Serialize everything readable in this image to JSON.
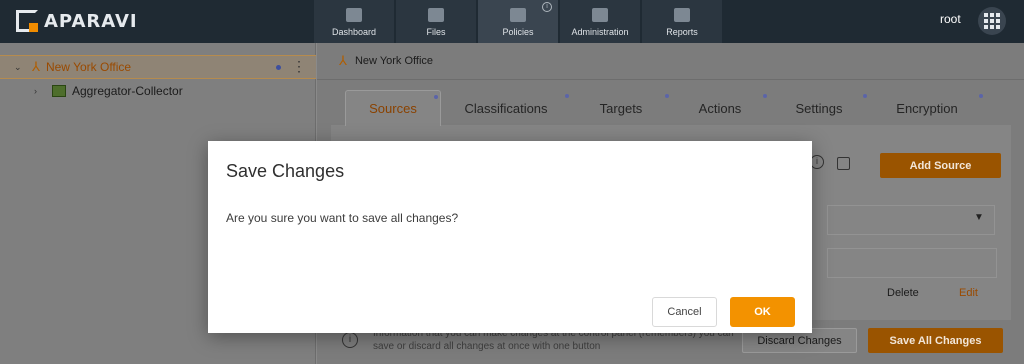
{
  "brand": {
    "name": "APARAVI",
    "trademark": "®"
  },
  "nav": {
    "items": [
      {
        "label": "Dashboard",
        "icon": "dashboard-icon"
      },
      {
        "label": "Files",
        "icon": "folder-icon"
      },
      {
        "label": "Policies",
        "icon": "policies-icon",
        "active": true
      },
      {
        "label": "Administration",
        "icon": "users-icon"
      },
      {
        "label": "Reports",
        "icon": "clipboard-icon"
      }
    ]
  },
  "user": {
    "name": "root"
  },
  "tree": {
    "items": [
      {
        "label": "New York Office",
        "chevron": "⌄",
        "selected": true
      },
      {
        "label": "Aggregator-Collector",
        "chevron": "›"
      }
    ]
  },
  "breadcrumb": {
    "label": "New York Office"
  },
  "tabs": [
    "Sources",
    "Classifications",
    "Targets",
    "Actions",
    "Settings",
    "Encryption"
  ],
  "content": {
    "add_source": "Add Source",
    "delete": "Delete",
    "edit": "Edit",
    "info_line1": "Information that you can make changes at the control panel (remembers) you can",
    "info_line2": "save or discard all changes at once with one button",
    "discard": "Discard Changes",
    "save_all": "Save All Changes"
  },
  "modal": {
    "title": "Save Changes",
    "body": "Are you sure you want to save all changes?",
    "cancel": "Cancel",
    "ok": "OK"
  },
  "colors": {
    "accent": "#f39200",
    "topbar": "#1f2a33"
  }
}
